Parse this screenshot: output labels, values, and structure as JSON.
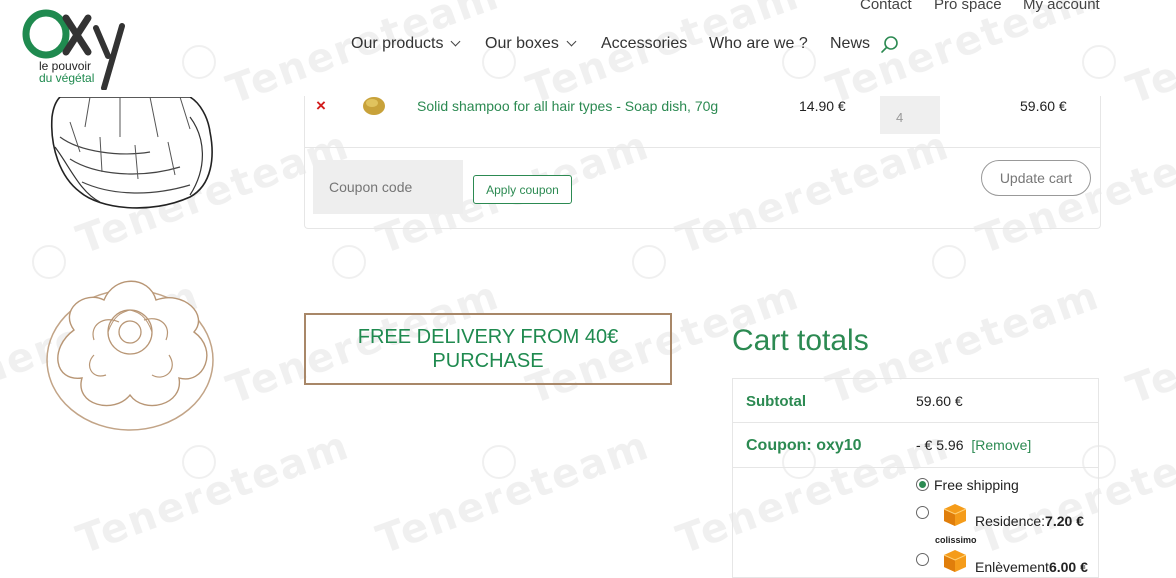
{
  "logo": {
    "brand": "OXy",
    "tagline_line1": "le pouvoir",
    "tagline_line2": "du végétal"
  },
  "top_links": [
    "Contact",
    "Pro space",
    "My account"
  ],
  "nav": {
    "items": [
      {
        "label": "Our products",
        "dropdown": true
      },
      {
        "label": "Our boxes",
        "dropdown": true
      },
      {
        "label": "Accessories",
        "dropdown": false
      },
      {
        "label": "Who are we ?",
        "dropdown": false
      },
      {
        "label": "News",
        "dropdown": false
      }
    ],
    "search_icon": "search-icon"
  },
  "watermark": "Tenereteam",
  "cart": {
    "item": {
      "remove_icon": "×",
      "name": "Solid shampoo for all hair types - Soap dish, 70g",
      "price": "14.90  €",
      "quantity": "4",
      "subtotal": "59.60  €"
    },
    "coupon_placeholder": "Coupon code",
    "apply_coupon_label": "Apply coupon",
    "update_cart_label": "Update cart"
  },
  "banner": {
    "line1": "FREE DELIVERY FROM 40€",
    "line2": "PURCHASE"
  },
  "totals": {
    "title": "Cart totals",
    "subtotal_label": "Subtotal",
    "subtotal_value": "59.60  €",
    "coupon_label": "Coupon: oxy10",
    "coupon_value": "- € 5.96",
    "coupon_remove": "[Remove]",
    "shipping_options": [
      {
        "label": "Free shipping",
        "selected": true
      },
      {
        "label": "Residence:",
        "price": "7.20  €",
        "carrier": "colissimo",
        "selected": false
      },
      {
        "label": "Enlèvement",
        "price": "6.00  €",
        "carrier": "colissimo",
        "selected": false
      }
    ]
  },
  "colors": {
    "accent": "#2c8a52",
    "brand_logo": "#1f8a4f",
    "banner_border": "#a88768",
    "remove": "#d21c1c"
  }
}
